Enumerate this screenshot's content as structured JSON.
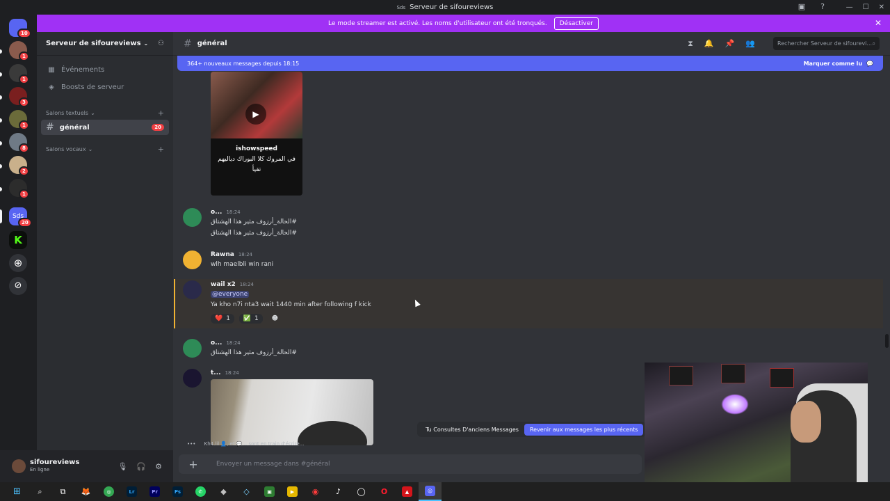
{
  "window": {
    "title": "Serveur de sifoureviews",
    "logo_text": "Sds"
  },
  "banner": {
    "text": "Le mode streamer est activé. Les noms d'utilisateur ont été tronqués.",
    "button": "Désactiver"
  },
  "servers": [
    {
      "badge": "10",
      "color": "#5865f2"
    },
    {
      "badge": "1",
      "color": "#8a5b4d"
    },
    {
      "badge": "1",
      "color": "#3a3a3a"
    },
    {
      "badge": "3",
      "color": "#7a1f1f"
    },
    {
      "badge": "1",
      "color": "#6b6b3a"
    },
    {
      "badge": "8",
      "color": "#6f7a86"
    },
    {
      "badge": "2",
      "color": "#c9b08b"
    },
    {
      "badge": "1",
      "color": "#2c2c2c"
    },
    {
      "badge": "20",
      "label": "Sds",
      "color": "#5865f2"
    },
    {
      "label": "K",
      "color": "#53fc18"
    }
  ],
  "sidebar": {
    "server_name": "Serveur de sifoureviews",
    "events": "Événements",
    "boosts": "Boosts de serveur",
    "text_category": "Salons textuels",
    "voice_category": "Salons vocaux",
    "channel": {
      "name": "général",
      "count": "20"
    }
  },
  "user": {
    "name": "sifoureviews",
    "status": "En ligne"
  },
  "header": {
    "channel": "général",
    "search_placeholder": "Rechercher Serveur de sifourevi..."
  },
  "new_messages": {
    "text": "364+ nouveaux messages depuis 18:15",
    "action": "Marquer comme lu"
  },
  "video1": {
    "author": "ishowspeed",
    "caption_line1": "في المروك كلا البوراك دياليهم",
    "caption_line2": "تقيأ"
  },
  "messages": [
    {
      "author": "o...",
      "time": "18:24",
      "lines": [
        "#الحالة_أرزوف مثير هذا الهشتاق",
        "#الحالة_أرزوف مثير هذا الهشتاق"
      ]
    },
    {
      "author": "Rawna",
      "time": "18:24",
      "lines": [
        "wlh maelbli win rani"
      ]
    },
    {
      "author": "wail x2",
      "time": "18:24",
      "mention": "@everyone",
      "lines": [
        "Ya kho n7i nta3 wait 1440 min after following f kick"
      ],
      "reactions": [
        {
          "emoji": "❤️",
          "count": "1"
        },
        {
          "emoji": "✅",
          "count": "1"
        }
      ]
    },
    {
      "author": "o...",
      "time": "18:24",
      "lines": [
        "#الحالة_أرزوف مثير هذا الهشتاق"
      ]
    },
    {
      "author": "t...",
      "time": "18:24",
      "lines": []
    }
  ],
  "typing": "Kh4.lil 👤, et 💬... sont en train d'écrire...",
  "composer": {
    "placeholder": "Envoyer un message dans #général"
  },
  "old_messages": {
    "text": "Tu Consultes D'anciens Messages",
    "button": "Revenir aux messages les plus récents"
  },
  "taskbar": [
    "⊞",
    "⌕",
    "⧉",
    "🦊",
    "◎",
    "Lr",
    "Pr",
    "Ps",
    "✆",
    "◆",
    "◇",
    "▣",
    "▶",
    "◉",
    "♪",
    "◯",
    "O",
    "▲",
    "☺"
  ]
}
